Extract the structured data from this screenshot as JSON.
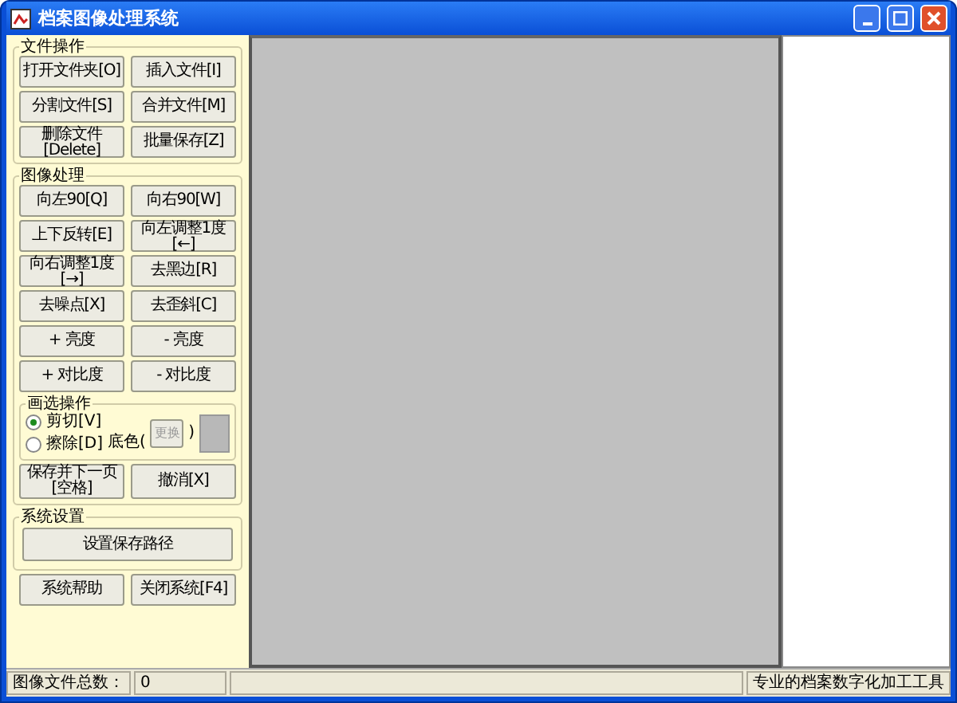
{
  "window": {
    "title": "档案图像处理系统"
  },
  "file_ops": {
    "legend": "文件操作",
    "buttons": [
      "打开文件夹[O]",
      "插入文件[I]",
      "分割文件[S]",
      "合并文件[M]",
      "删除文件\n[Delete]",
      "批量保存[Z]"
    ]
  },
  "image_ops": {
    "legend": "图像处理",
    "buttons": [
      "向左90[Q]",
      "向右90[W]",
      "上下反转[E]",
      "向左调整1度\n[←]",
      "向右调整1度\n[→]",
      "去黑边[R]",
      "去噪点[X]",
      "去歪斜[C]",
      "+ 亮度",
      "- 亮度",
      "+ 对比度",
      "- 对比度"
    ],
    "selection": {
      "legend": "画选操作",
      "modes": [
        {
          "label": "剪切[V]",
          "selected": true
        },
        {
          "label": "擦除[D]",
          "selected": false
        }
      ],
      "bg_label": "底色(",
      "change_button": {
        "label": "更换",
        "disabled": true
      },
      "bg_close": ")"
    },
    "actions": [
      "保存并下一页\n[空格]",
      "撤消[X]"
    ]
  },
  "system_settings": {
    "legend": "系统设置",
    "buttons": [
      "设置保存路径"
    ]
  },
  "bottom_buttons": [
    "系统帮助",
    "关闭系统[F4]"
  ],
  "status_bar": {
    "count_label": "图像文件总数：",
    "count": "0",
    "slogan": "专业的档案数字化加工工具"
  }
}
